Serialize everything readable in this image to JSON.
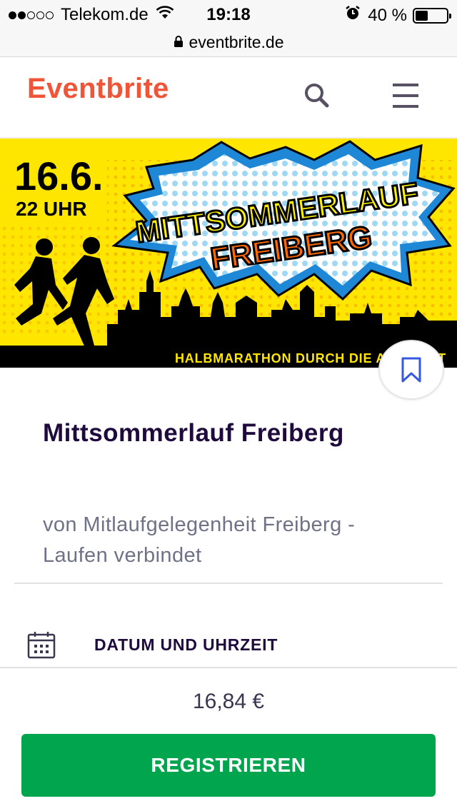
{
  "status_bar": {
    "carrier": "Telekom.de",
    "time": "19:18",
    "battery_percent_text": "40 %",
    "battery_level": 0.4,
    "signal_bars_filled": 2,
    "signal_bars_total": 5
  },
  "browser": {
    "url": "eventbrite.de"
  },
  "header": {
    "logo_text": "Eventbrite",
    "brand_color": "#f05537",
    "search_icon": "search-icon",
    "menu_icon": "hamburger-menu-icon"
  },
  "banner": {
    "date_text": "16.6.",
    "time_text": "22 UHR",
    "headline_line1": "MITTSOMMERLAUF",
    "headline_line2": "FREIBERG",
    "tagline": "HALBMARATHON DURCH DIE ALTSTADT"
  },
  "event": {
    "title": "Mittsommerlauf Freiberg",
    "organizer": "von Mitlaufgelegenheit Freiberg - Laufen verbindet",
    "save_icon": "bookmark-icon"
  },
  "details": {
    "date_section_label": "DATUM UND UHRZEIT",
    "date_icon": "calendar-icon"
  },
  "checkout": {
    "price": "16,84 €",
    "register_label": "REGISTRIEREN",
    "button_color": "#00a54d"
  }
}
